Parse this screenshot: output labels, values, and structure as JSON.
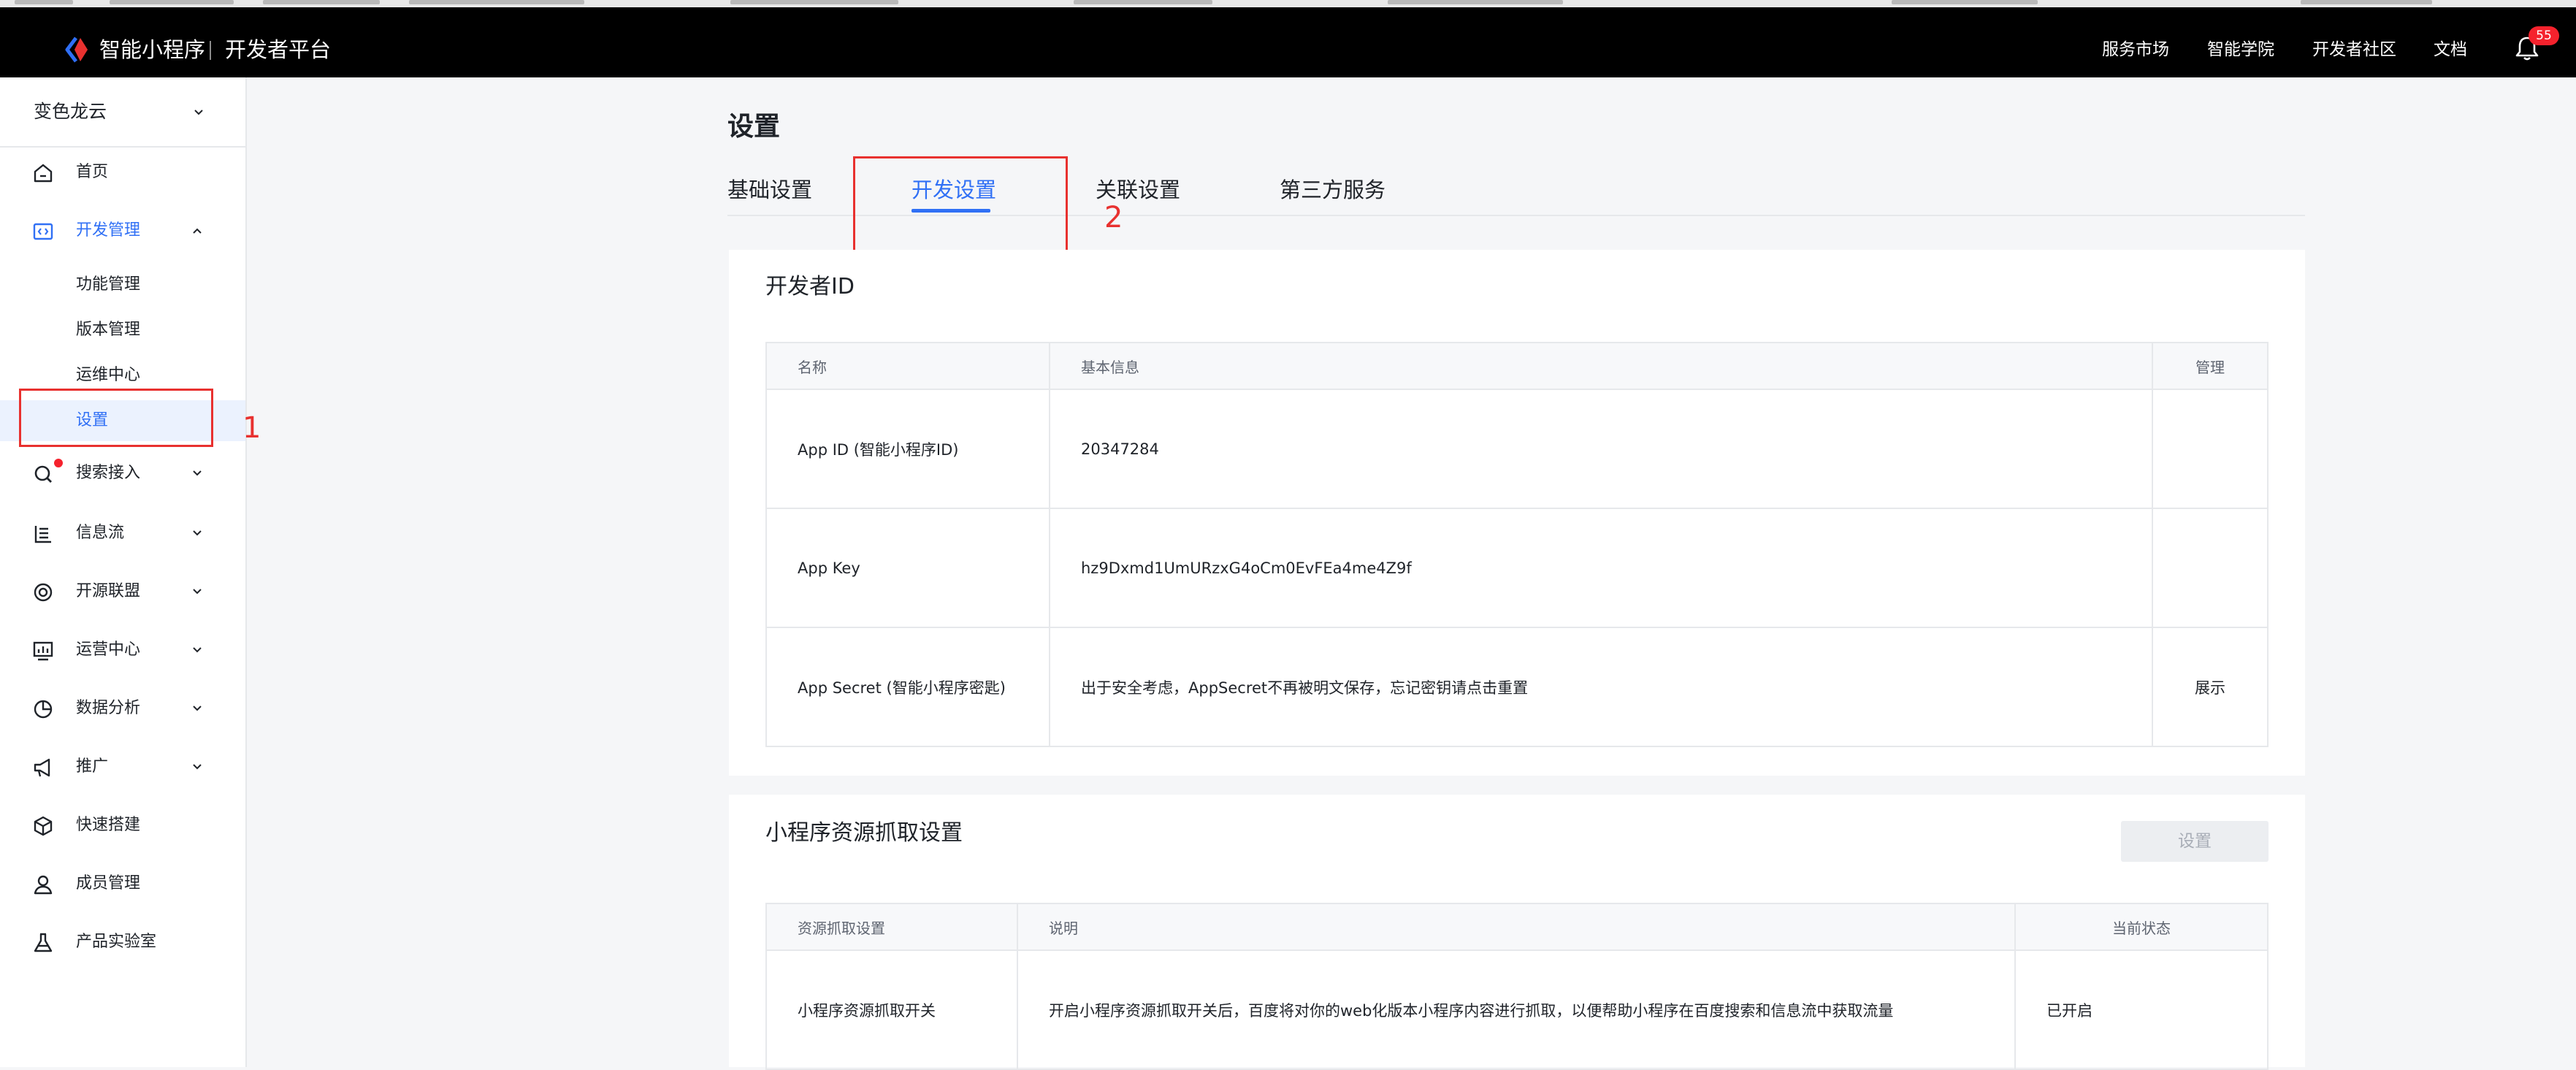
{
  "topbar": {
    "brand": "智能小程序",
    "platform": "开发者平台",
    "nav": [
      "服务市场",
      "智能学院",
      "开发者社区",
      "文档"
    ],
    "notification_count": "55",
    "accent_color": "#3070f5"
  },
  "sidebar": {
    "app_name": "变色龙云",
    "items": [
      {
        "label": "首页",
        "icon": "home-icon"
      },
      {
        "label": "开发管理",
        "icon": "code-icon",
        "expanded": true
      },
      {
        "label": "搜索接入",
        "icon": "search-icon"
      },
      {
        "label": "信息流",
        "icon": "feed-icon"
      },
      {
        "label": "开源联盟",
        "icon": "alliance-icon"
      },
      {
        "label": "运营中心",
        "icon": "operations-icon"
      },
      {
        "label": "数据分析",
        "icon": "pie-chart-icon"
      },
      {
        "label": "推广",
        "icon": "megaphone-icon"
      },
      {
        "label": "快速搭建",
        "icon": "cube-icon"
      },
      {
        "label": "成员管理",
        "icon": "user-icon"
      },
      {
        "label": "产品实验室",
        "icon": "flask-icon"
      }
    ],
    "dev_sub_items": [
      "功能管理",
      "版本管理",
      "运维中心",
      "设置"
    ],
    "active_sub_item": "设置"
  },
  "annotations": {
    "one": "1",
    "two": "2"
  },
  "main": {
    "title": "设置",
    "tabs": [
      "基础设置",
      "开发设置",
      "关联设置",
      "第三方服务"
    ],
    "active_tab": "开发设置",
    "developer_id": {
      "title": "开发者ID",
      "columns": [
        "名称",
        "基本信息",
        "管理"
      ],
      "rows": [
        {
          "name": "App ID (智能小程序ID)",
          "info": "20347284",
          "action": ""
        },
        {
          "name": "App Key",
          "info": "hz9Dxmd1UmURzxG4oCm0EvFEa4me4Z9f",
          "action": ""
        },
        {
          "name": "App Secret (智能小程序密匙)",
          "info": "出于安全考虑，AppSecret不再被明文保存，忘记密钥请点击重置",
          "action": "展示"
        }
      ]
    },
    "resource_crawl": {
      "title": "小程序资源抓取设置",
      "button": "设置",
      "columns": [
        "资源抓取设置",
        "说明",
        "当前状态"
      ],
      "rows": [
        {
          "name": "小程序资源抓取开关",
          "desc": "开启小程序资源抓取开关后，百度将对你的web化版本小程序内容进行抓取，以便帮助小程序在百度搜索和信息流中获取流量",
          "status": "已开启"
        }
      ]
    }
  }
}
